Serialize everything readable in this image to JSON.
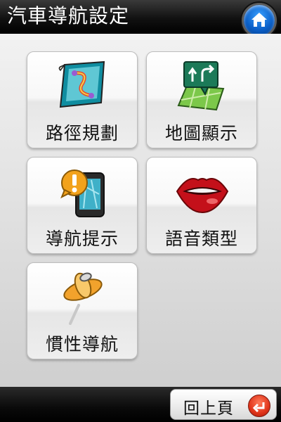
{
  "header": {
    "title": "汽車導航設定"
  },
  "menu": {
    "items": [
      {
        "label": "路徑規劃",
        "icon": "route-map-icon"
      },
      {
        "label": "地圖顯示",
        "icon": "map-display-icon"
      },
      {
        "label": "導航提示",
        "icon": "navigation-alert-icon"
      },
      {
        "label": "語音類型",
        "icon": "lips-icon"
      },
      {
        "label": "慣性導航",
        "icon": "pushpin-icon"
      }
    ]
  },
  "footer": {
    "back_label": "回上頁"
  },
  "colors": {
    "accent_blue": "#0a5fc8",
    "back_red": "#e0341a"
  }
}
